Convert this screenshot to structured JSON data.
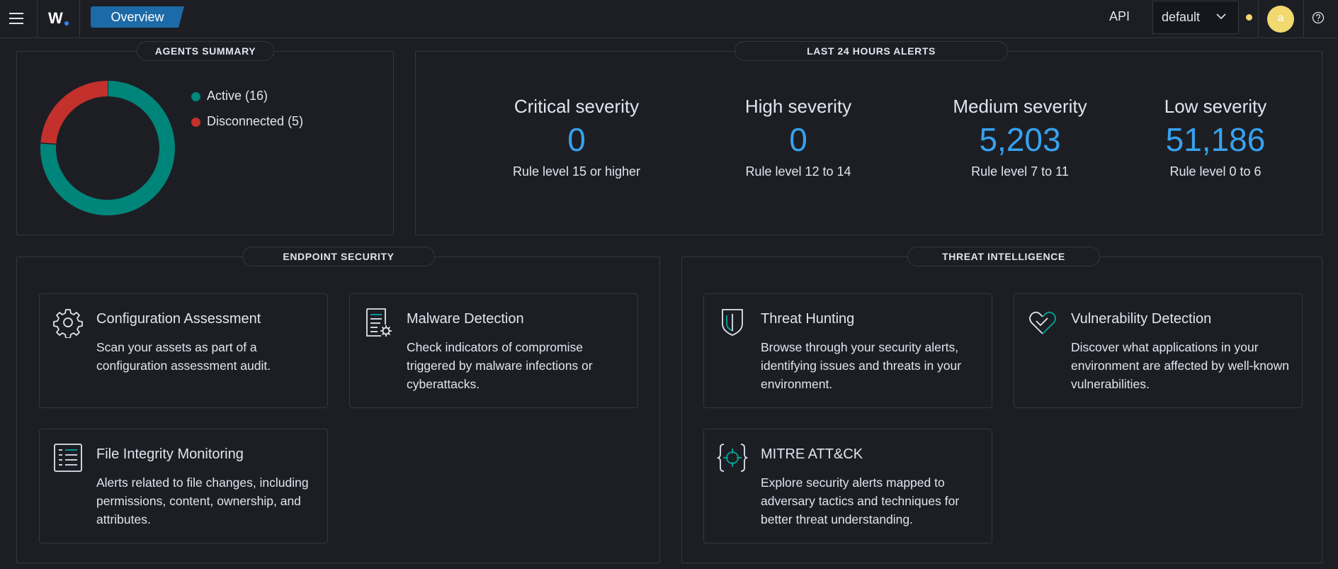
{
  "header": {
    "logo_text": "W",
    "breadcrumb": "Overview",
    "api_label": "API",
    "selector_value": "default",
    "avatar_initial": "a",
    "status_color": "#f1d86f"
  },
  "agents_summary": {
    "title": "AGENTS SUMMARY",
    "legend": [
      {
        "label": "Active (16)",
        "color": "#00857a"
      },
      {
        "label": "Disconnected (5)",
        "color": "#c4302b"
      }
    ]
  },
  "chart_data": {
    "type": "pie",
    "categories": [
      "Active",
      "Disconnected"
    ],
    "values": [
      16,
      5
    ],
    "colors": [
      "#00857a",
      "#c4302b"
    ],
    "title": "AGENTS SUMMARY"
  },
  "alerts": {
    "title": "LAST 24 HOURS ALERTS",
    "items": [
      {
        "label": "Critical severity",
        "value": "0",
        "rule": "Rule level 15 or higher"
      },
      {
        "label": "High severity",
        "value": "0",
        "rule": "Rule level 12 to 14"
      },
      {
        "label": "Medium severity",
        "value": "5,203",
        "rule": "Rule level 7 to 11"
      },
      {
        "label": "Low severity",
        "value": "51,186",
        "rule": "Rule level 0 to 6"
      }
    ]
  },
  "endpoint": {
    "title": "ENDPOINT SECURITY",
    "cards": [
      {
        "icon": "gear-icon",
        "title": "Configuration Assessment",
        "desc": "Scan your assets as part of a configuration assessment audit."
      },
      {
        "icon": "document-gear-icon",
        "title": "Malware Detection",
        "desc": "Check indicators of compromise triggered by malware infections or cyberattacks."
      },
      {
        "icon": "file-list-icon",
        "title": "File Integrity Monitoring",
        "desc": "Alerts related to file changes, including permissions, content, ownership, and attributes."
      }
    ]
  },
  "threat": {
    "title": "THREAT INTELLIGENCE",
    "cards": [
      {
        "icon": "shield-icon",
        "title": "Threat Hunting",
        "desc": "Browse through your security alerts, identifying issues and threats in your environment."
      },
      {
        "icon": "heart-check-icon",
        "title": "Vulnerability Detection",
        "desc": "Discover what applications in your environment are affected by well-known vulnerabilities."
      },
      {
        "icon": "crosshair-icon",
        "title": "MITRE ATT&CK",
        "desc": "Explore security alerts mapped to adversary tactics and techniques for better threat understanding."
      }
    ]
  }
}
